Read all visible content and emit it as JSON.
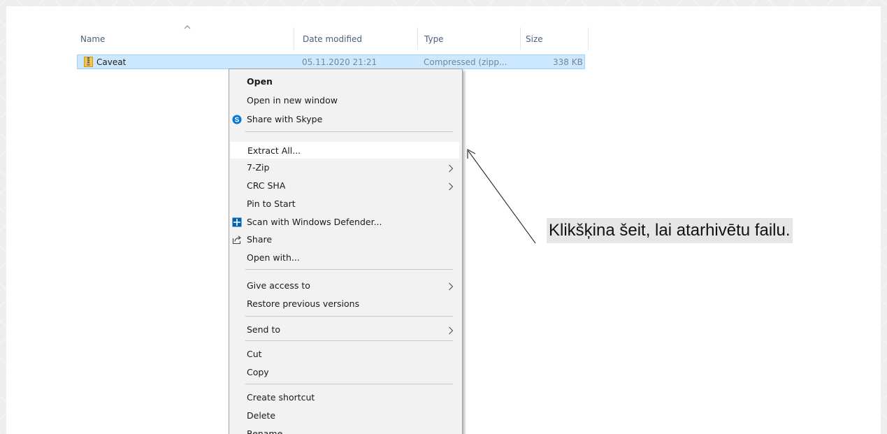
{
  "columns": {
    "name": "Name",
    "date_modified": "Date modified",
    "type": "Type",
    "size": "Size"
  },
  "file": {
    "name": "Caveat",
    "date_modified": "05.11.2020 21:21",
    "type": "Compressed (zipp...",
    "size": "338 KB",
    "icon": "zip-folder-icon"
  },
  "context_menu": {
    "items": [
      {
        "label": "Open"
      },
      {
        "label": "Open in new window"
      },
      {
        "label": "Share with Skype",
        "icon": "skype-icon"
      },
      {
        "label": "Extract All..."
      },
      {
        "label": "7-Zip"
      },
      {
        "label": "CRC SHA"
      },
      {
        "label": "Pin to Start"
      },
      {
        "label": "Scan with Windows Defender...",
        "icon": "windows-defender-icon"
      },
      {
        "label": "Share",
        "icon": "share-icon"
      },
      {
        "label": "Open with..."
      },
      {
        "label": "Give access to"
      },
      {
        "label": "Restore previous versions"
      },
      {
        "label": "Send to"
      },
      {
        "label": "Cut"
      },
      {
        "label": "Copy"
      },
      {
        "label": "Create shortcut"
      },
      {
        "label": "Delete"
      },
      {
        "label": "Rename"
      }
    ]
  },
  "annotation": {
    "text": "Klikšķina šeit, lai atarhivētu failu."
  },
  "colors": {
    "selection": "#cce8ff",
    "selection_border": "#99d1ff",
    "menu_background": "#f2f2f2",
    "skype_blue": "#0078d4",
    "defender_blue": "#0063b1"
  }
}
